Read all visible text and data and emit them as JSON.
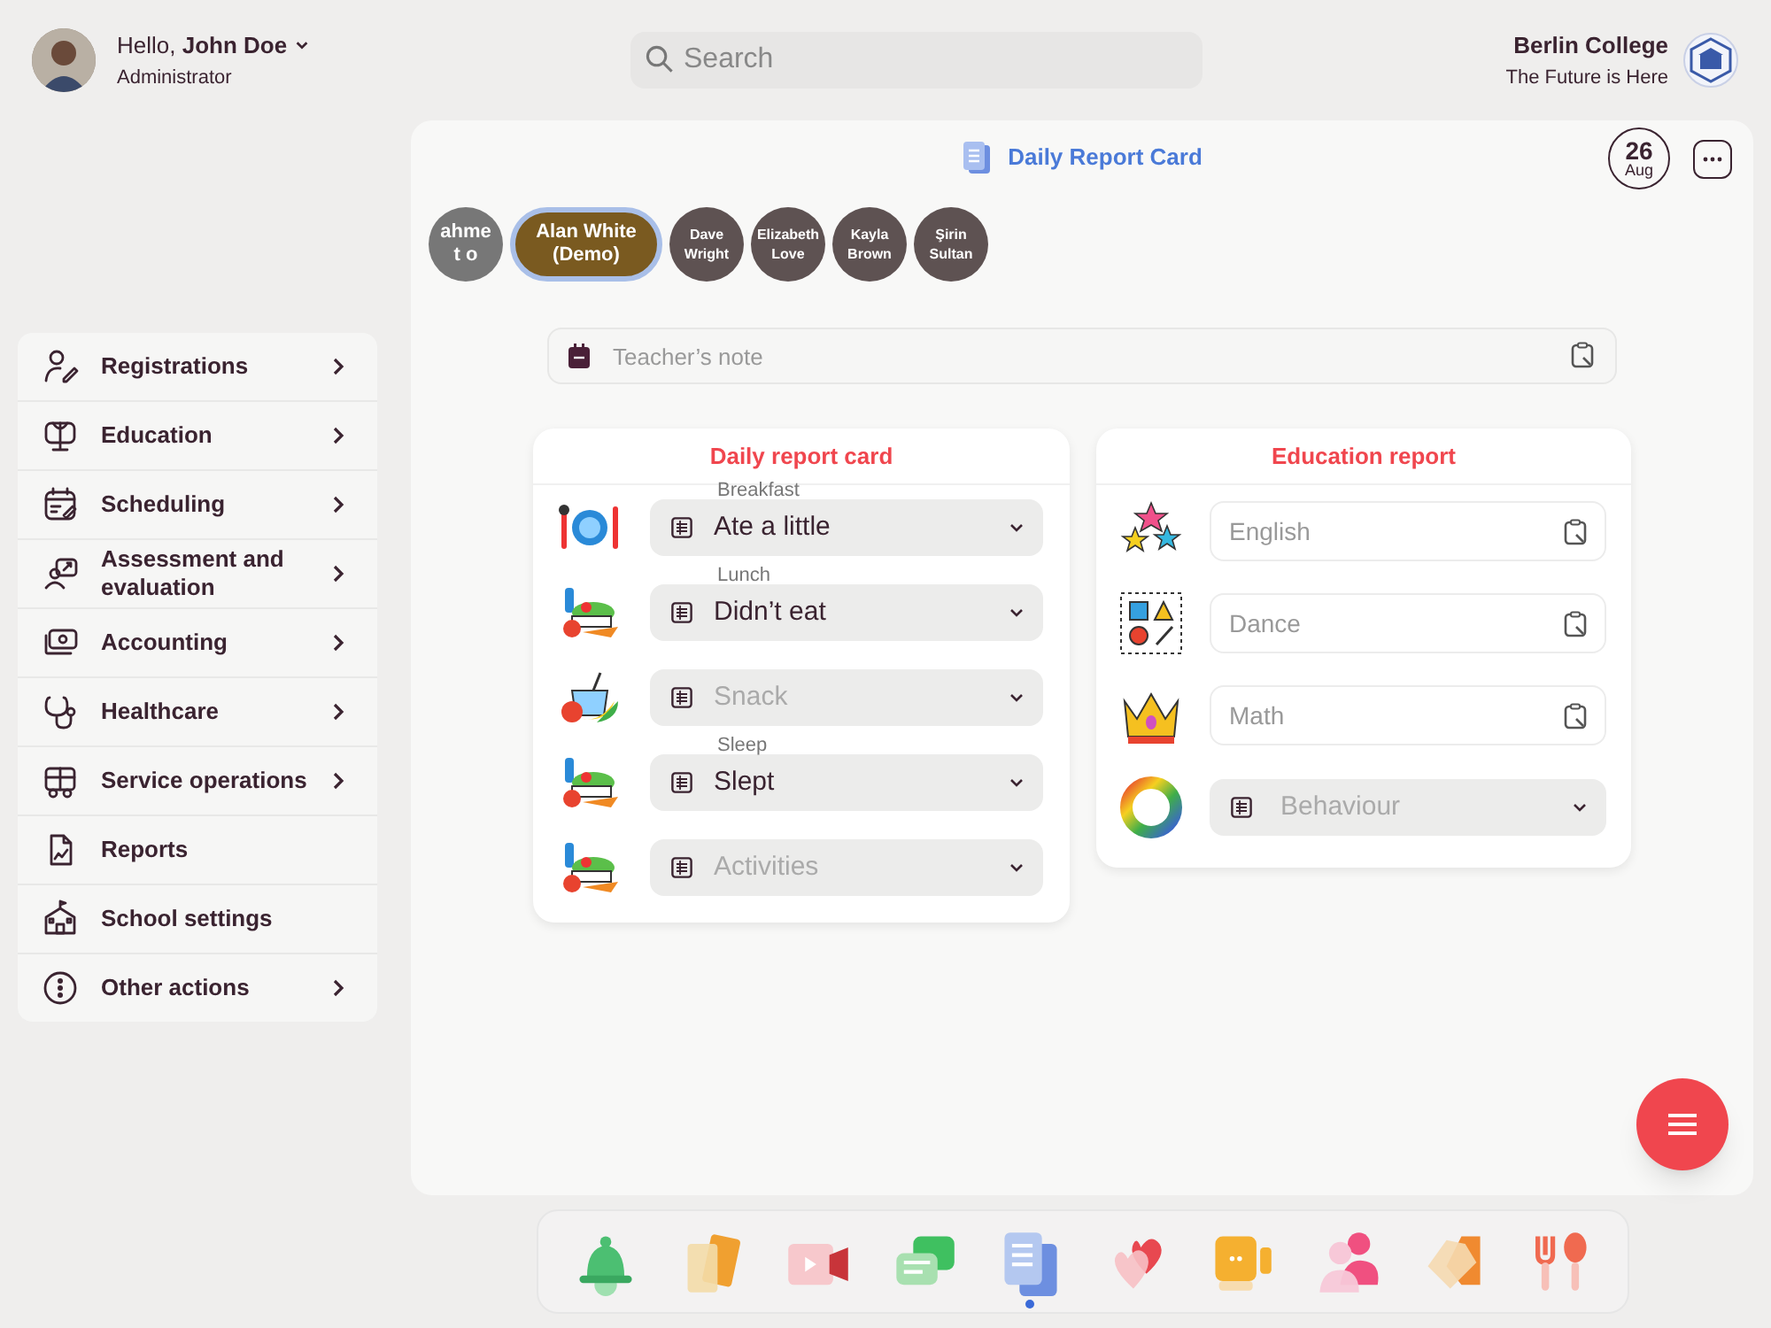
{
  "header": {
    "greeting": "Hello, **John Doe**",
    "role": "Administrator",
    "search": {
      "placeholder": "Search"
    },
    "college": {
      "name": "Berlin College",
      "tagline": "The Future is Here"
    }
  },
  "sidebar": {
    "items": [
      {
        "label": "Registrations",
        "has_submenu": true
      },
      {
        "label": "Education",
        "has_submenu": true
      },
      {
        "label": "Scheduling",
        "has_submenu": true
      },
      {
        "label": "Assessment and evaluation",
        "has_submenu": true
      },
      {
        "label": "Accounting",
        "has_submenu": true
      },
      {
        "label": "Healthcare",
        "has_submenu": true
      },
      {
        "label": "Service operations",
        "has_submenu": true
      },
      {
        "label": "Reports",
        "has_submenu": false
      },
      {
        "label": "School settings",
        "has_submenu": false
      },
      {
        "label": "Other actions",
        "has_submenu": true
      }
    ]
  },
  "main": {
    "title": "Daily Report Card",
    "date": {
      "day": "26",
      "month": "Aug"
    },
    "students": [
      {
        "label": "ahmet o",
        "selected": false
      },
      {
        "label": "Alan White (Demo)",
        "selected": true
      },
      {
        "label": "Dave Wright",
        "selected": false
      },
      {
        "label": "Elizabeth Love",
        "selected": false
      },
      {
        "label": "Kayla Brown",
        "selected": false
      },
      {
        "label": "Şirin Sultan",
        "selected": false
      }
    ],
    "teacher_note": {
      "placeholder": "Teacher’s note"
    },
    "daily_report": {
      "title": "Daily report card",
      "rows": [
        {
          "label": "Breakfast",
          "value": "Ate a little"
        },
        {
          "label": "Lunch",
          "value": "Didn’t eat"
        },
        {
          "placeholder": "Snack"
        },
        {
          "label": "Sleep",
          "value": "Slept"
        },
        {
          "placeholder": "Activities"
        }
      ]
    },
    "education_report": {
      "title": "Education report",
      "rows": [
        {
          "kind": "field",
          "placeholder": "English"
        },
        {
          "kind": "field",
          "placeholder": "Dance"
        },
        {
          "kind": "field",
          "placeholder": "Math"
        },
        {
          "kind": "select",
          "placeholder": "Behaviour"
        }
      ]
    }
  },
  "dock": {
    "items": [
      {
        "selected": false
      },
      {
        "selected": false
      },
      {
        "selected": false
      },
      {
        "selected": false
      },
      {
        "selected": true
      },
      {
        "selected": false
      },
      {
        "selected": false
      },
      {
        "selected": false
      },
      {
        "selected": false
      },
      {
        "selected": false
      }
    ]
  }
}
